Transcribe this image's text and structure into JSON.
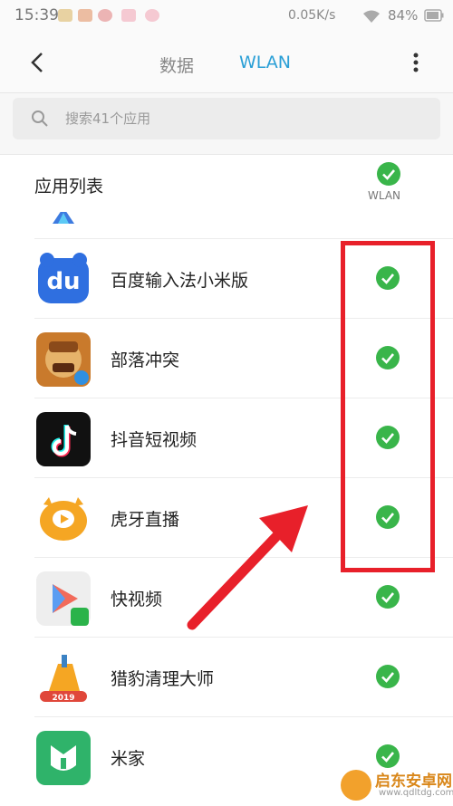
{
  "status_bar": {
    "time": "15:39",
    "net_speed": "0.05K/s",
    "battery": "84%"
  },
  "nav": {
    "tabs": [
      "数据",
      "WLAN"
    ],
    "active_tab": "WLAN"
  },
  "search": {
    "placeholder": "搜索41个应用"
  },
  "list_header": {
    "title": "应用列表",
    "column_label": "WLAN"
  },
  "apps": [
    {
      "name": "百度输入法小米版",
      "icon": "baidu-input-icon",
      "wlan_allowed": true
    },
    {
      "name": "部落冲突",
      "icon": "clash-of-clans-icon",
      "wlan_allowed": true
    },
    {
      "name": "抖音短视频",
      "icon": "douyin-icon",
      "wlan_allowed": true
    },
    {
      "name": "虎牙直播",
      "icon": "huya-icon",
      "wlan_allowed": true
    },
    {
      "name": "快视频",
      "icon": "kuaishipin-icon",
      "wlan_allowed": true
    },
    {
      "name": "猎豹清理大师",
      "icon": "cleanmaster-icon",
      "wlan_allowed": true
    },
    {
      "name": "米家",
      "icon": "mijia-icon",
      "wlan_allowed": true
    }
  ],
  "watermark": {
    "text": "启东安卓网",
    "url": "www.qdltdg.com"
  },
  "colors": {
    "accent": "#2a9fd6",
    "check_green": "#39b54a",
    "highlight_red": "#e8202a"
  }
}
